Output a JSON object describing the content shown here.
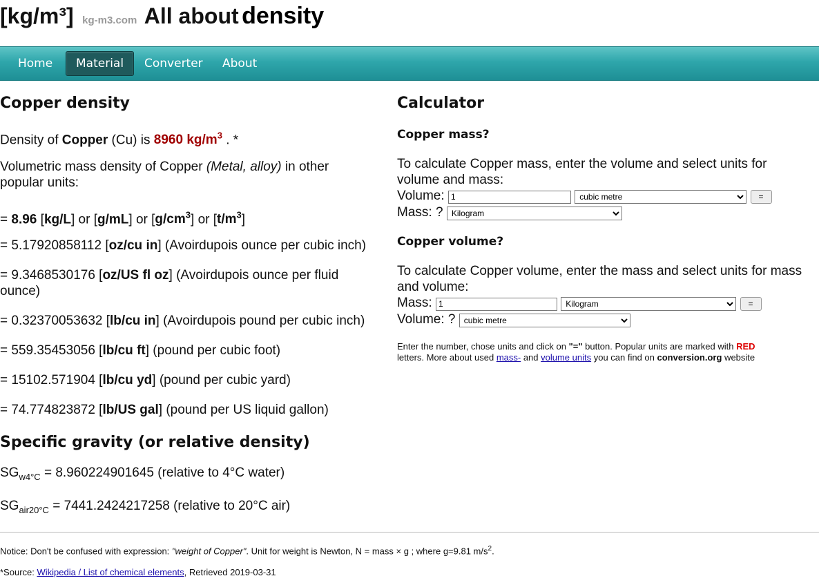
{
  "brand": {
    "code": "[kg/m³]",
    "site": "kg-m3.com",
    "title_prefix": "All about",
    "title_word": "density"
  },
  "nav": {
    "items": [
      {
        "label": "Home"
      },
      {
        "label": "Material"
      },
      {
        "label": "Converter"
      },
      {
        "label": "About"
      }
    ]
  },
  "left": {
    "heading": "Copper density",
    "density_prefix": "Density of",
    "material": "Copper",
    "symbol": "(Cu) is",
    "density_value": "8960 kg/m",
    "density_sup": "3",
    "density_suffix": ". *",
    "volumetric_line1_prefix": "Volumetric mass density of Copper",
    "volumetric_type": "(Metal, alloy)",
    "volumetric_line1_suffix": "in other",
    "volumetric_line2": "popular units:",
    "rows": [
      {
        "prefix": "=",
        "value": "8.96"
      },
      {
        "prefix": "= 5.17920858112",
        "unit": "oz/cu in",
        "desc": "(Avoirdupois ounce per cubic inch)"
      },
      {
        "prefix": "= 9.3468530176",
        "unit": "oz/US fl oz",
        "desc": "(Avoirdupois ounce per fluid",
        "desc2": "ounce)"
      },
      {
        "prefix": "= 0.32370053632",
        "unit": "lb/cu in",
        "desc": "(Avoirdupois pound per cubic inch)"
      },
      {
        "prefix": "= 559.35453056",
        "unit": "lb/cu ft",
        "desc": "(pound per cubic foot)"
      },
      {
        "prefix": "= 15102.571904",
        "unit": "lb/cu yd",
        "desc": "(pound per cubic yard)"
      },
      {
        "prefix": "= 74.774823872",
        "unit": "lb/US gal",
        "desc": "(pound per US liquid gallon)"
      }
    ],
    "sg_heading": "Specific gravity (or relative density)",
    "sg_water_sub": "w4°C",
    "sg_water_value": "= 8.960224901645 (relative to 4°C water)",
    "sg_air_sub": "air20°C",
    "sg_air_value": "= 7441.2424217258 (relative to 20°C air)",
    "sg": "SG"
  },
  "right": {
    "heading": "Calculator",
    "mass_heading": "Copper mass?",
    "mass_intro": "To calculate Copper mass, enter the volume and select units for volume and mass:",
    "volume_label": "Volume:",
    "volume_value": "1",
    "volume_unit": "cubic metre",
    "mass_result_label": "Mass: ?",
    "mass_result_unit": "Kilogram",
    "eq_label": "=",
    "volume_heading": "Copper volume?",
    "volume_intro": "To calculate Copper volume, enter the mass and select units for mass and volume:",
    "mass_label": "Mass:",
    "mass_value": "1",
    "mass_unit": "Kilogram",
    "volume_result_label": "Volume: ?",
    "volume_result_unit": "cubic metre",
    "help_1": "Enter the number, chose units and click on ",
    "help_eq": "\"=\"",
    "help_2": " button. Popular units are marked with ",
    "help_red": "RED",
    "help_3": "letters. More about used ",
    "help_link1": "mass-",
    "help_4": " and ",
    "help_link2": "volume units",
    "help_5": " you can find on ",
    "help_site": "conversion.org",
    "help_6": " website"
  },
  "footer": {
    "notice_1": "Notice: Don't be confused with expression: ",
    "notice_quote": "\"weight of Copper\"",
    "notice_2": ". Unit for weight is Newton, N = mass × g ; where g=9.81 m/s",
    "notice_sup": "2",
    "notice_end": ".",
    "source_1": "*Source: ",
    "source_link": "Wikipedia / List of chemical elements",
    "source_2": ", Retrieved 2019-03-31"
  },
  "colors": {
    "accent": "#2ea6ab",
    "nav_active": "#1f5a5c",
    "density_red": "#a00000",
    "link": "#1a0dab"
  }
}
